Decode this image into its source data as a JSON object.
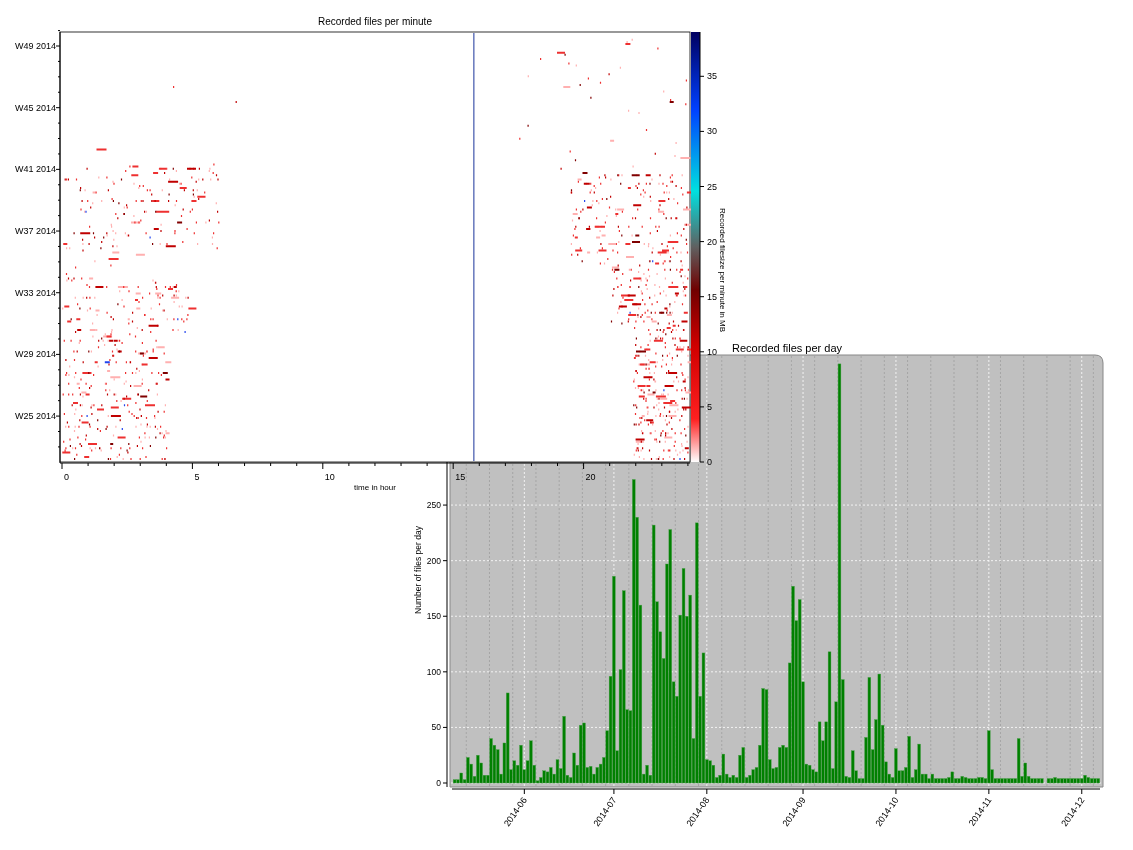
{
  "heatmap": {
    "title": "Recorded files per minute",
    "xlabel": "time in hour",
    "xticks": [
      "0",
      "5",
      "10",
      "15",
      "20"
    ],
    "yticks": [
      "W49 2014",
      "W45 2014",
      "W41 2014",
      "W37 2014",
      "W33 2014",
      "W29 2014",
      "W25 2014"
    ],
    "colorbar": {
      "label": "Recorded filesize per minute in MB",
      "ticks": [
        "35",
        "30",
        "25",
        "20",
        "15",
        "10",
        "5",
        "0"
      ]
    }
  },
  "bar_window": {
    "chart_data": {
      "type": "bar",
      "title": "Recorded files per day",
      "ylabel": "Number of files per day",
      "ylim": [
        0,
        385
      ],
      "yticks": [
        0,
        50,
        100,
        150,
        200,
        250
      ],
      "categories": [
        null,
        null,
        null,
        null,
        null,
        null,
        null,
        null,
        null,
        null,
        null,
        null,
        null,
        null,
        null,
        null,
        null,
        null,
        null,
        null,
        null,
        "2014-06",
        null,
        null,
        null,
        null,
        null,
        null,
        null,
        null,
        null,
        null,
        null,
        null,
        null,
        null,
        null,
        null,
        null,
        null,
        null,
        null,
        null,
        null,
        null,
        null,
        null,
        null,
        "2014-07",
        null,
        null,
        null,
        null,
        null,
        null,
        null,
        null,
        null,
        null,
        null,
        null,
        null,
        null,
        null,
        null,
        null,
        null,
        null,
        null,
        null,
        null,
        null,
        null,
        null,
        null,
        null,
        "2014-08",
        null,
        null,
        null,
        null,
        null,
        null,
        null,
        null,
        null,
        null,
        null,
        null,
        null,
        null,
        null,
        null,
        null,
        null,
        null,
        null,
        null,
        null,
        null,
        null,
        null,
        null,
        null,
        null,
        "2014-09",
        null,
        null,
        null,
        null,
        null,
        null,
        null,
        null,
        null,
        null,
        null,
        null,
        null,
        null,
        null,
        null,
        null,
        null,
        null,
        null,
        null,
        null,
        null,
        null,
        null,
        null,
        null,
        "2014-10",
        null,
        null,
        null,
        null,
        null,
        null,
        null,
        null,
        null,
        null,
        null,
        null,
        null,
        null,
        null,
        null,
        null,
        null,
        null,
        null,
        null,
        null,
        null,
        null,
        null,
        null,
        null,
        "2014-11",
        null,
        null,
        null,
        null,
        null,
        null,
        null,
        null,
        null,
        null,
        null,
        null,
        null,
        null,
        null,
        null,
        null,
        null,
        null,
        null,
        null,
        null,
        null,
        null,
        null,
        null,
        null,
        "2014-12",
        null,
        null,
        null,
        null,
        null
      ],
      "grid": true,
      "series": [
        {
          "color": "#008000",
          "values": [
            3,
            3,
            9,
            3,
            23,
            17,
            6,
            25,
            18,
            7,
            7,
            40,
            34,
            30,
            8,
            36,
            81,
            12,
            20,
            16,
            34,
            12,
            20,
            38,
            16,
            2,
            5,
            11,
            10,
            14,
            8,
            21,
            13,
            60,
            7,
            5,
            27,
            16,
            52,
            54,
            14,
            15,
            8,
            14,
            17,
            23,
            47,
            96,
            186,
            29,
            102,
            173,
            66,
            65,
            273,
            239,
            160,
            8,
            16,
            7,
            232,
            163,
            136,
            112,
            197,
            228,
            91,
            78,
            151,
            193,
            150,
            169,
            40,
            234,
            78,
            117,
            21,
            20,
            16,
            5,
            7,
            26,
            8,
            5,
            7,
            5,
            25,
            32,
            5,
            7,
            12,
            14,
            34,
            85,
            84,
            21,
            13,
            14,
            32,
            34,
            32,
            108,
            177,
            146,
            165,
            91,
            17,
            16,
            12,
            10,
            55,
            38,
            55,
            118,
            13,
            73,
            377,
            93,
            6,
            5,
            29,
            11,
            4,
            4,
            41,
            95,
            30,
            57,
            98,
            52,
            19,
            8,
            5,
            31,
            11,
            11,
            14,
            42,
            5,
            12,
            35,
            8,
            8,
            4,
            8,
            4,
            4,
            4,
            4,
            5,
            10,
            4,
            4,
            6,
            5,
            4,
            4,
            4,
            5,
            5,
            4,
            47,
            12,
            4,
            4,
            4,
            4,
            4,
            4,
            4,
            40,
            6,
            18,
            6,
            4,
            4,
            4,
            4,
            null,
            4,
            4,
            5,
            4,
            4,
            4,
            4,
            4,
            4,
            4,
            4,
            7,
            5,
            4,
            4,
            4
          ]
        }
      ]
    }
  }
}
